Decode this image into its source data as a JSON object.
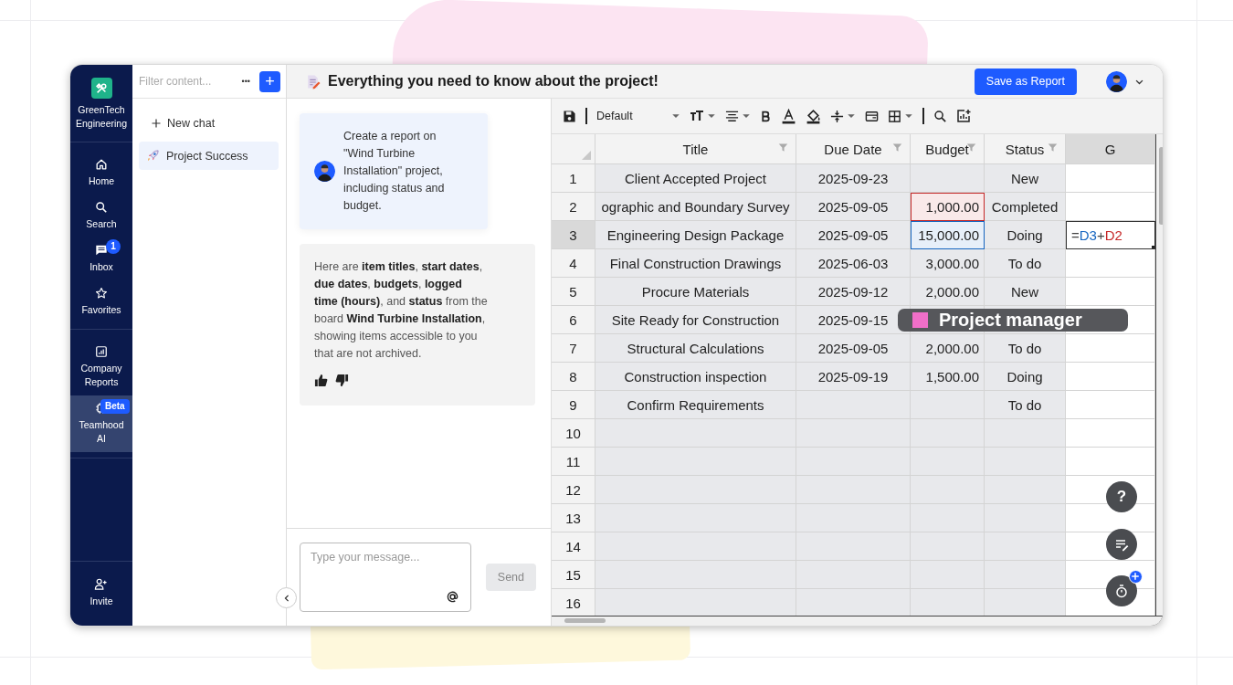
{
  "nav": {
    "brand": "GreenTech Engineering",
    "groups": [
      [
        {
          "label": "Home",
          "selected": false
        },
        {
          "label": "Search",
          "selected": false
        },
        {
          "label": "Inbox",
          "selected": false,
          "badge": "1"
        },
        {
          "label": "Favorites",
          "selected": false
        }
      ],
      [
        {
          "label": "Company Reports",
          "selected": false
        },
        {
          "label": "Teamhood AI",
          "selected": true,
          "badge": "Beta"
        }
      ]
    ],
    "bottom": {
      "label": "Invite"
    }
  },
  "chat_list": {
    "filter_placeholder": "Filter content...",
    "more": "•••",
    "add": "+",
    "new_chat": "New chat",
    "chats": [
      {
        "label": "Project Success",
        "selected": true
      }
    ]
  },
  "header": {
    "title": "Everything you need to know about the project!",
    "save_button": "Save as Report"
  },
  "messages": [
    {
      "kind": "user",
      "text": "Create a report on \"Wind Turbine Installation\" project, including status and budget."
    },
    {
      "kind": "assistant",
      "text": "Here are **item titles**, **start dates**, **due dates**, **budgets**, **logged time (hours)**, and **status** from the board **Wind Turbine Installation**, showing items accessible to you that are not archived."
    }
  ],
  "composer": {
    "placeholder": "Type your message...",
    "send": "Send",
    "send_disabled": true
  },
  "sheet": {
    "font": "Default",
    "columns": [
      {
        "label": "Title",
        "filter": true,
        "selected": false
      },
      {
        "label": "Due Date",
        "filter": true,
        "selected": false
      },
      {
        "label": "Budget",
        "filter": true,
        "selected": false
      },
      {
        "label": "Status",
        "filter": true,
        "selected": false
      },
      {
        "label": "G",
        "filter": false,
        "selected": true
      }
    ],
    "rows": [
      {
        "number": "1",
        "title": "Client Accepted Project",
        "due": "2025-09-23",
        "status": "New",
        "selected": false
      },
      {
        "number": "2",
        "title": "ographic and Boundary Survey",
        "due": "2025-09-05",
        "budget": "1,000.00",
        "budget_ref": {
          "color": "#c62828"
        },
        "status": "Completed",
        "selected": false
      },
      {
        "number": "3",
        "title": "Engineering Design Package",
        "due": "2025-09-05",
        "budget": "15,000.00",
        "budget_ref": {
          "color": "#1565c0"
        },
        "status": "Doing",
        "selected": true,
        "formula": [
          {
            "text": "=",
            "color": "#444444"
          },
          {
            "text": "D3",
            "color": "#1565c0"
          },
          {
            "text": "+",
            "color": "#444444"
          },
          {
            "text": "D2",
            "color": "#c62828"
          }
        ]
      },
      {
        "number": "4",
        "title": "Final Construction Drawings",
        "due": "2025-06-03",
        "budget": "3,000.00",
        "status": "To do",
        "selected": false
      },
      {
        "number": "5",
        "title": "Procure Materials",
        "due": "2025-09-12",
        "budget": "2,000.00",
        "status": "New",
        "selected": false
      },
      {
        "number": "6",
        "title": "Site Ready for Construction",
        "due": "2025-09-15",
        "selected": false
      },
      {
        "number": "7",
        "title": "Structural Calculations",
        "due": "2025-09-05",
        "budget": "2,000.00",
        "status": "To do",
        "selected": false
      },
      {
        "number": "8",
        "title": "Construction inspection",
        "due": "2025-09-19",
        "budget": "1,500.00",
        "status": "Doing",
        "selected": false
      },
      {
        "number": "9",
        "title": "Confirm Requirements",
        "status": "To do",
        "selected": false
      },
      {
        "number": "10",
        "selected": false
      },
      {
        "number": "11",
        "selected": false
      },
      {
        "number": "12",
        "selected": false
      },
      {
        "number": "13",
        "selected": false
      },
      {
        "number": "14",
        "selected": false
      },
      {
        "number": "15",
        "selected": false
      },
      {
        "number": "16",
        "selected": false
      }
    ],
    "presence": {
      "label": "Project manager"
    },
    "help": "?"
  }
}
